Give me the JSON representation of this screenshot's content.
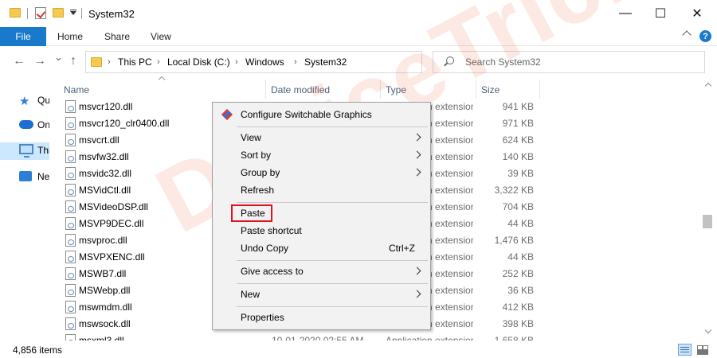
{
  "window": {
    "title": "System32",
    "minimize": "—",
    "maximize": "☐",
    "close": "✕"
  },
  "ribbon": {
    "file": "File",
    "tabs": [
      "Home",
      "Share",
      "View"
    ],
    "help": "?"
  },
  "nav": {
    "back": "←",
    "forward": "→",
    "recent": "⌄",
    "up": "↑",
    "breadcrumb": [
      "This PC",
      "Local Disk (C:)",
      "Windows",
      "System32"
    ],
    "refresh": "↻"
  },
  "search": {
    "placeholder": "Search System32"
  },
  "sidebar": {
    "items": [
      {
        "label": "Quick access"
      },
      {
        "label": "OneDrive"
      },
      {
        "label": "This PC"
      },
      {
        "label": "Network"
      }
    ]
  },
  "columns": {
    "name": "Name",
    "date": "Date modified",
    "type": "Type",
    "size": "Size"
  },
  "files": [
    {
      "name": "msvcr120.dll",
      "date": "",
      "type": "Application extension",
      "size": "941 KB"
    },
    {
      "name": "msvcr120_clr0400.dll",
      "date": "",
      "type": "Application extension",
      "size": "971 KB"
    },
    {
      "name": "msvcrt.dll",
      "date": "",
      "type": "Application extension",
      "size": "624 KB"
    },
    {
      "name": "msvfw32.dll",
      "date": "",
      "type": "Application extension",
      "size": "140 KB"
    },
    {
      "name": "msvidc32.dll",
      "date": "",
      "type": "Application extension",
      "size": "39 KB"
    },
    {
      "name": "MSVidCtl.dll",
      "date": "",
      "type": "Application extension",
      "size": "3,322 KB"
    },
    {
      "name": "MSVideoDSP.dll",
      "date": "",
      "type": "Application extension",
      "size": "704 KB"
    },
    {
      "name": "MSVP9DEC.dll",
      "date": "",
      "type": "Application extension",
      "size": "44 KB"
    },
    {
      "name": "msvproc.dll",
      "date": "",
      "type": "Application extension",
      "size": "1,476 KB"
    },
    {
      "name": "MSVPXENC.dll",
      "date": "",
      "type": "Application extension",
      "size": "44 KB"
    },
    {
      "name": "MSWB7.dll",
      "date": "",
      "type": "Application extension",
      "size": "252 KB"
    },
    {
      "name": "MSWebp.dll",
      "date": "",
      "type": "Application extension",
      "size": "36 KB"
    },
    {
      "name": "mswmdm.dll",
      "date": "",
      "type": "Application extension",
      "size": "412 KB"
    },
    {
      "name": "mswsock.dll",
      "date": "",
      "type": "Application extension",
      "size": "398 KB"
    },
    {
      "name": "msxml3.dll",
      "date": "10-01-2020 02:55 AM",
      "type": "Application extension",
      "size": "1,658 KB"
    }
  ],
  "context_menu": {
    "items": [
      {
        "label": "Configure Switchable Graphics",
        "shortcut": "",
        "submenu": false
      },
      {
        "label": "View",
        "shortcut": "",
        "submenu": true
      },
      {
        "label": "Sort by",
        "shortcut": "",
        "submenu": true
      },
      {
        "label": "Group by",
        "shortcut": "",
        "submenu": true
      },
      {
        "label": "Refresh",
        "shortcut": "",
        "submenu": false
      },
      {
        "label": "Paste",
        "shortcut": "",
        "submenu": false
      },
      {
        "label": "Paste shortcut",
        "shortcut": "",
        "submenu": false
      },
      {
        "label": "Undo Copy",
        "shortcut": "Ctrl+Z",
        "submenu": false
      },
      {
        "label": "Give access to",
        "shortcut": "",
        "submenu": true
      },
      {
        "label": "New",
        "shortcut": "",
        "submenu": true
      },
      {
        "label": "Properties",
        "shortcut": "",
        "submenu": false
      }
    ]
  },
  "status": {
    "count": "4,856 items"
  },
  "watermark": "DeviceTricks",
  "colors": {
    "accent": "#1979ca",
    "selection": "#cce8ff",
    "highlight_box": "#e0141e"
  }
}
